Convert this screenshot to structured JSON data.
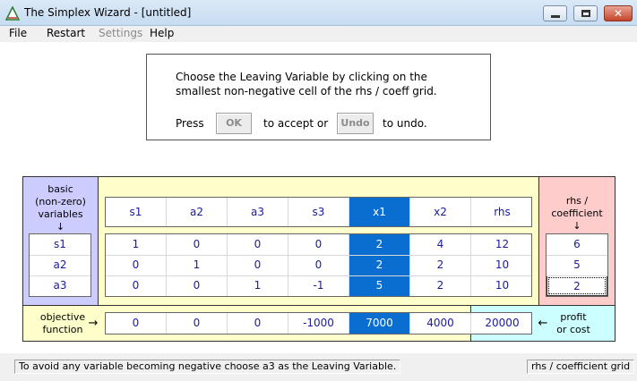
{
  "window": {
    "title": "The Simplex Wizard - [untitled]",
    "close_glyph": "✕"
  },
  "menu": {
    "file": "File",
    "restart": "Restart",
    "settings": "Settings",
    "help": "Help"
  },
  "instructions": {
    "line1": "Choose the Leaving Variable by clicking on the",
    "line2": "smallest non-negative cell of the rhs / coeff grid.",
    "press": "Press",
    "ok_label": "OK",
    "accept_text": "to accept or",
    "undo_label": "Undo",
    "undo_text": "to undo."
  },
  "labels": {
    "basic_l1": "basic",
    "basic_l2": "(non-zero)",
    "basic_l3": "variables",
    "down_arrow": "↓",
    "rhs_l1": "rhs /",
    "rhs_l2": "coefficient",
    "objective_l1": "objective",
    "objective_l2": "function",
    "right_arrow": "→",
    "left_arrow": "←",
    "profit_l1": "profit",
    "profit_l2": "or cost"
  },
  "tableau": {
    "headers": [
      "s1",
      "a2",
      "a3",
      "s3",
      "x1",
      "x2",
      "rhs"
    ],
    "basic_vars": [
      "s1",
      "a2",
      "a3"
    ],
    "rows": [
      [
        "1",
        "0",
        "0",
        "0",
        "2",
        "4",
        "12"
      ],
      [
        "0",
        "1",
        "0",
        "0",
        "2",
        "2",
        "10"
      ],
      [
        "0",
        "0",
        "1",
        "-1",
        "5",
        "2",
        "10"
      ]
    ],
    "ratios": [
      "6",
      "5",
      "2"
    ],
    "objective": [
      "0",
      "0",
      "0",
      "-1000",
      "7000",
      "4000",
      "20000"
    ],
    "selected_column": "x1",
    "selected_color": "#0a6ed1"
  },
  "status": {
    "message": "To avoid any variable becoming negative choose a3 as the Leaving Variable.",
    "pane": "rhs / coefficient grid"
  }
}
